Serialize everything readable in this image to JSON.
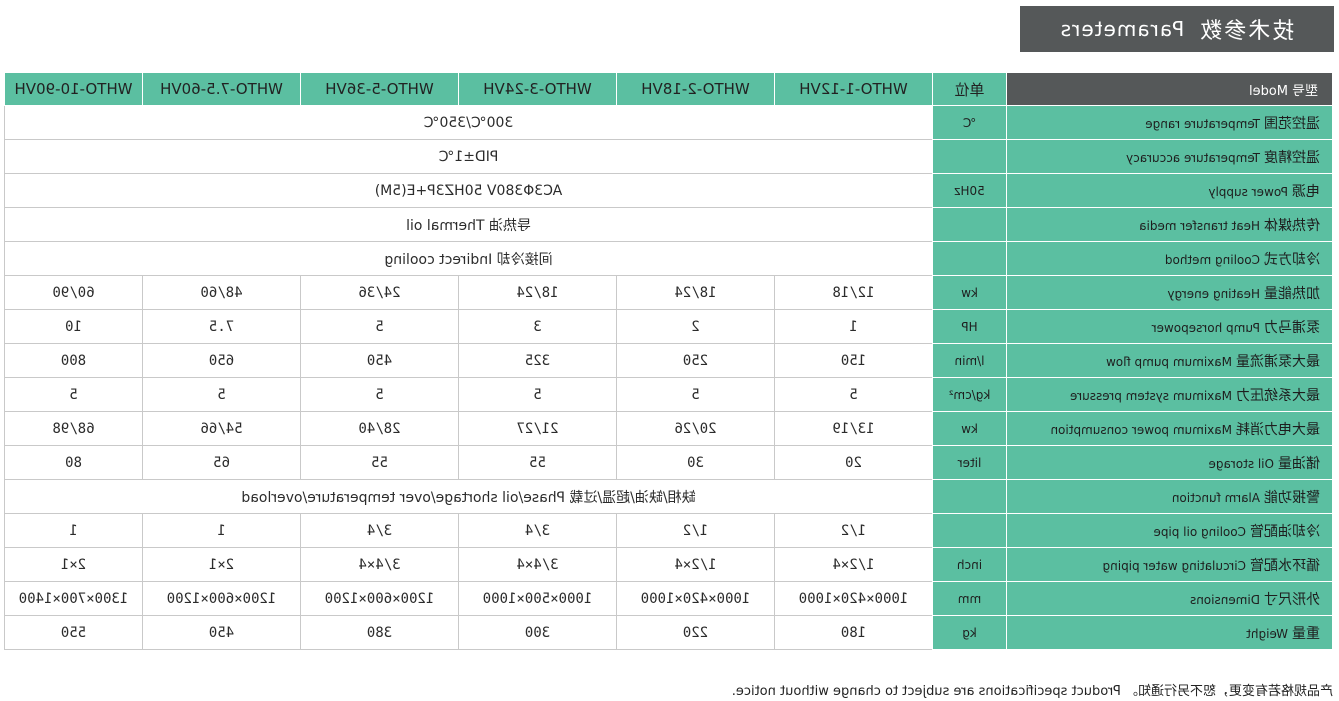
{
  "header": {
    "title_cn": "技术参数",
    "title_en": "Parameters"
  },
  "table": {
    "header": {
      "label_cn": "型号",
      "label_en": "Model",
      "unit": "单位",
      "models": [
        "WHTO-1-12VH",
        "WHTO-2-18VH",
        "WHTO-3-24VH",
        "WHTO-5-36VH",
        "WHTO-7.5-60VH",
        "WHTO-10-90VH"
      ]
    },
    "rows": [
      {
        "cn": "温控范围",
        "en": "Temperature range",
        "unit": "℃",
        "span": "300℃/350℃"
      },
      {
        "cn": "温控精度",
        "en": "Temperature accuracy",
        "unit": "",
        "span": "PID±1℃"
      },
      {
        "cn": "电源",
        "en": "Power supply",
        "unit": "50Hz",
        "span": "AC3Φ380V 50HZ3P+E(5M)"
      },
      {
        "cn": "传热媒体",
        "en": "Heat transfer media",
        "unit": "",
        "span": "导热油 Thermal oil"
      },
      {
        "cn": "冷却方式",
        "en": "Cooling method",
        "unit": "",
        "span": "间接冷却 Indirect cooling"
      },
      {
        "cn": "加热能量",
        "en": "Heating energy",
        "unit": "kw",
        "values": [
          "12/18",
          "18/24",
          "18/24",
          "24/36",
          "48/60",
          "60/90"
        ]
      },
      {
        "cn": "泵浦马力",
        "en": "Pump horsepower",
        "unit": "HP",
        "values": [
          "1",
          "2",
          "3",
          "5",
          "7.5",
          "10"
        ]
      },
      {
        "cn": "最大泵浦流量",
        "en": "Maximum pump flow",
        "unit": "l/min",
        "values": [
          "150",
          "250",
          "325",
          "450",
          "650",
          "800"
        ]
      },
      {
        "cn": "最大系统压力",
        "en": "Maximum system pressure",
        "unit": "kg/cm²",
        "values": [
          "5",
          "5",
          "5",
          "5",
          "5",
          "5"
        ]
      },
      {
        "cn": "最大电力消耗",
        "en": "Maximum power consumption",
        "unit": "kw",
        "values": [
          "13/19",
          "20/26",
          "21/27",
          "28/40",
          "54/66",
          "68/98"
        ]
      },
      {
        "cn": "储油量",
        "en": "Oil storage",
        "unit": "liter",
        "values": [
          "20",
          "30",
          "55",
          "55",
          "65",
          "80"
        ]
      },
      {
        "cn": "警报功能",
        "en": "Alarm function",
        "unit": "",
        "span": "缺相/缺油/超温/过载 Phase/oil shortage/over temperature/overload"
      },
      {
        "cn": "冷却油配管",
        "en": "Cooling oil pipe",
        "unit": "",
        "values": [
          "1/2",
          "1/2",
          "3/4",
          "3/4",
          "1",
          "1"
        ]
      },
      {
        "cn": "循环水配管",
        "en": "Circulating water piping",
        "unit": "inch",
        "values": [
          "1/2×4",
          "1/2×4",
          "3/4×4",
          "3/4×4",
          "2×1",
          "2×1"
        ]
      },
      {
        "cn": "外形尺寸",
        "en": "Dimensions",
        "unit": "mm",
        "values": [
          "1000×420×1000",
          "1000×420×1000",
          "1000×500×1000",
          "1200×600×1200",
          "1200×600×1200",
          "1300×700×1400"
        ]
      },
      {
        "cn": "重量",
        "en": "Weight",
        "unit": "kg",
        "values": [
          "180",
          "220",
          "300",
          "380",
          "450",
          "550"
        ]
      }
    ]
  },
  "footnote": "产品规格若有变更，恕不另行通知。 Product specifications are subject to change without notice."
}
